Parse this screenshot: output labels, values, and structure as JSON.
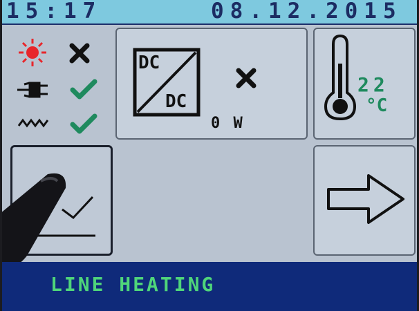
{
  "header": {
    "time": "15:17",
    "date": "08.12.2015"
  },
  "status": {
    "solar": {
      "icon": "sun-icon",
      "state": "cross-icon"
    },
    "grid": {
      "icon": "plug-icon",
      "state": "check-icon"
    },
    "heating": {
      "icon": "zigzag-icon",
      "state": "check-icon"
    }
  },
  "converter": {
    "top_label": "DC",
    "bottom_label": "DC",
    "state": "cross-icon",
    "power": "0 W"
  },
  "temperature": {
    "value": "22",
    "unit": "°C"
  },
  "footer": {
    "mode": "LINE HEATING"
  },
  "colors": {
    "header_bg": "#7ec9df",
    "footer_bg": "#0f2a7a",
    "accent_green": "#1f8a5e",
    "sun_red": "#e8262b",
    "footer_text": "#4fd57a"
  }
}
